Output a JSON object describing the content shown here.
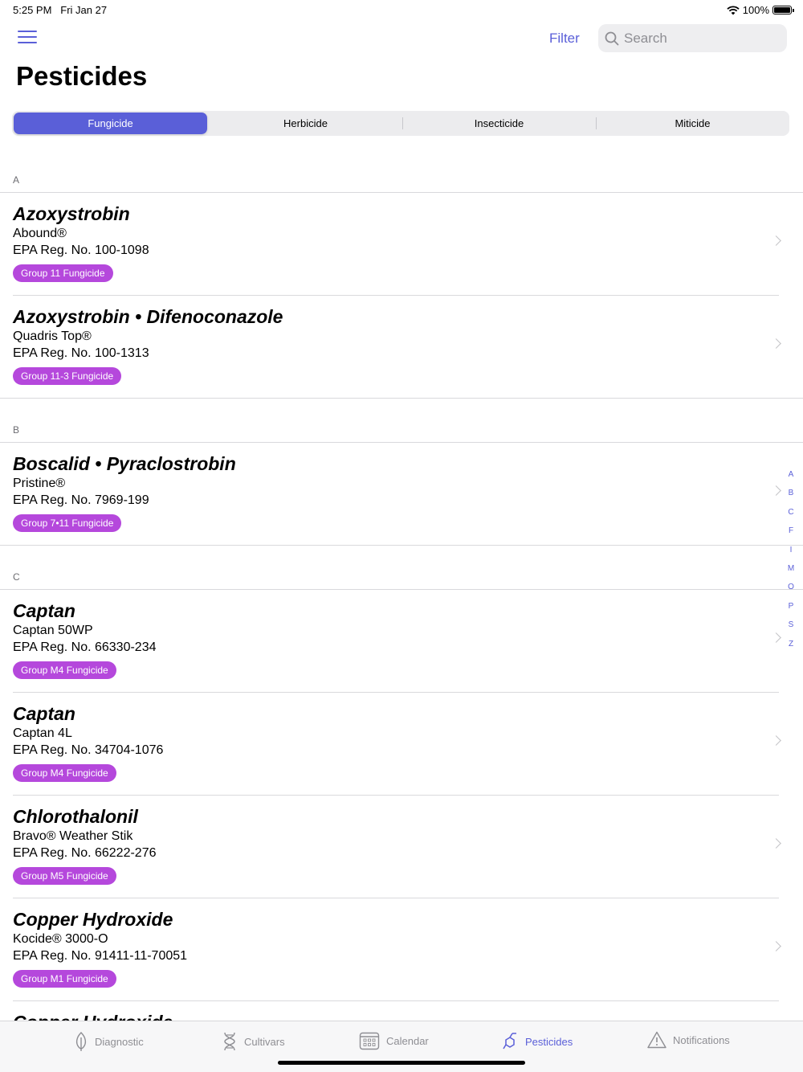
{
  "status_bar": {
    "time": "5:25 PM",
    "date": "Fri Jan 27",
    "battery": "100%"
  },
  "header": {
    "filter_label": "Filter",
    "search_placeholder": "Search",
    "title": "Pesticides"
  },
  "segments": [
    {
      "label": "Fungicide",
      "active": true
    },
    {
      "label": "Herbicide",
      "active": false
    },
    {
      "label": "Insecticide",
      "active": false
    },
    {
      "label": "Miticide",
      "active": false
    }
  ],
  "sections": [
    {
      "letter": "A",
      "items": [
        {
          "name": "Azoxystrobin",
          "trade": "Abound®",
          "epa": "EPA Reg. No. 100-1098",
          "group": "Group 11 Fungicide"
        },
        {
          "name": "Azoxystrobin • Difenoconazole",
          "trade": "Quadris Top®",
          "epa": "EPA Reg. No. 100-1313",
          "group": "Group 11-3 Fungicide"
        }
      ]
    },
    {
      "letter": "B",
      "items": [
        {
          "name": "Boscalid • Pyraclostrobin",
          "trade": "Pristine®",
          "epa": "EPA Reg. No. 7969-199",
          "group": "Group 7•11 Fungicide"
        }
      ]
    },
    {
      "letter": "C",
      "items": [
        {
          "name": "Captan",
          "trade": "Captan 50WP",
          "epa": "EPA Reg. No. 66330-234",
          "group": "Group M4 Fungicide"
        },
        {
          "name": "Captan",
          "trade": "Captan 4L",
          "epa": "EPA Reg. No. 34704-1076",
          "group": "Group M4 Fungicide"
        },
        {
          "name": "Chlorothalonil",
          "trade": "Bravo® Weather Stik",
          "epa": "EPA Reg. No. 66222-276",
          "group": "Group M5 Fungicide"
        },
        {
          "name": "Copper Hydroxide",
          "trade": "Kocide® 3000-O",
          "epa": "EPA Reg. No. 91411-11-70051",
          "group": "Group M1 Fungicide"
        },
        {
          "name": "Copper Hydroxide",
          "trade": "",
          "epa": "",
          "group": ""
        }
      ]
    }
  ],
  "index_letters": [
    "A",
    "B",
    "C",
    "F",
    "I",
    "M",
    "O",
    "P",
    "S",
    "Z"
  ],
  "tabs": [
    {
      "label": "Diagnostic",
      "icon": "leaf-icon",
      "active": false
    },
    {
      "label": "Cultivars",
      "icon": "dna-icon",
      "active": false
    },
    {
      "label": "Calendar",
      "icon": "calendar-icon",
      "active": false
    },
    {
      "label": "Pesticides",
      "icon": "molecule-icon",
      "active": true
    },
    {
      "label": "Notifications",
      "icon": "warning-icon",
      "active": false
    }
  ],
  "colors": {
    "accent": "#5a5fd8",
    "badge": "#b548dc",
    "separator": "#d9d9dc"
  }
}
